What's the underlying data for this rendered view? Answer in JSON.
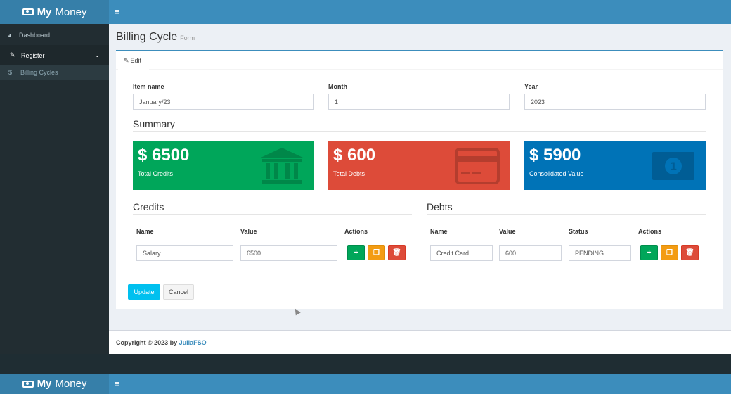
{
  "app": {
    "logo_bold": "My",
    "logo_text": "Money",
    "menu_icon": "bars-icon"
  },
  "sidebar": {
    "items": [
      {
        "label": "Dashboard",
        "icon": "dashboard-icon"
      },
      {
        "label": "Register",
        "icon": "edit-icon"
      }
    ],
    "subitems": [
      {
        "label": "Billing Cycles",
        "icon": "dollar-icon"
      }
    ]
  },
  "page": {
    "title": "Billing Cycle",
    "subtitle": "Form"
  },
  "tab": {
    "label": "Edit"
  },
  "form": {
    "name_label": "Item name",
    "name_value": "January/23",
    "month_label": "Month",
    "month_value": "1",
    "year_label": "Year",
    "year_value": "2023"
  },
  "summary": {
    "title": "Summary",
    "cards": [
      {
        "value": "$ 6500",
        "label": "Total Credits",
        "color": "#00a65a",
        "icon": "bank-icon"
      },
      {
        "value": "$ 600",
        "label": "Total Debts",
        "color": "#dd4b39",
        "icon": "credit-card-icon"
      },
      {
        "value": "$ 5900",
        "label": "Consolidated Value",
        "color": "#0073b7",
        "icon": "money-icon"
      }
    ]
  },
  "credits": {
    "title": "Credits",
    "headers": [
      "Name",
      "Value",
      "Actions"
    ],
    "rows": [
      {
        "name": "Salary",
        "value": "6500"
      }
    ]
  },
  "debts": {
    "title": "Debts",
    "headers": [
      "Name",
      "Value",
      "Status",
      "Actions"
    ],
    "rows": [
      {
        "name": "Credit Card",
        "value": "600",
        "status": "PENDING"
      }
    ]
  },
  "buttons": {
    "update": "Update",
    "cancel": "Cancel"
  },
  "footer": {
    "prefix": "Copyright © 2023 by",
    "brand": "JuliaFSO"
  }
}
